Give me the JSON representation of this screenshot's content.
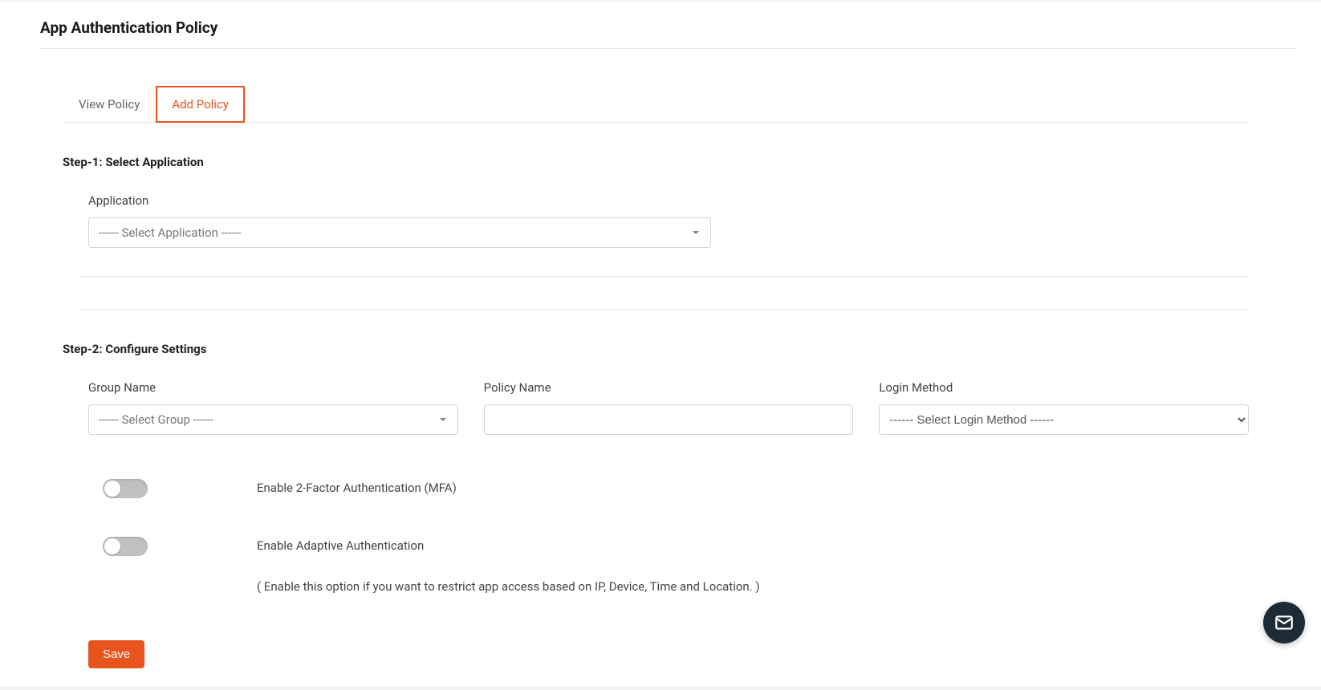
{
  "page_title": "App Authentication Policy",
  "tabs": {
    "view": "View Policy",
    "add": "Add Policy"
  },
  "step1": {
    "title": "Step-1: Select Application",
    "application_label": "Application",
    "application_placeholder": "------ Select Application ------"
  },
  "step2": {
    "title": "Step-2: Configure Settings",
    "group_name_label": "Group Name",
    "group_placeholder": "------ Select Group ------",
    "policy_name_label": "Policy Name",
    "policy_name_value": "",
    "login_method_label": "Login Method",
    "login_method_placeholder": "------ Select Login Method ------",
    "mfa_label": "Enable 2-Factor Authentication (MFA)",
    "adaptive_label": "Enable Adaptive Authentication",
    "adaptive_hint": "( Enable this option if you want to restrict app access based on IP, Device, Time and Location. )"
  },
  "save_label": "Save"
}
